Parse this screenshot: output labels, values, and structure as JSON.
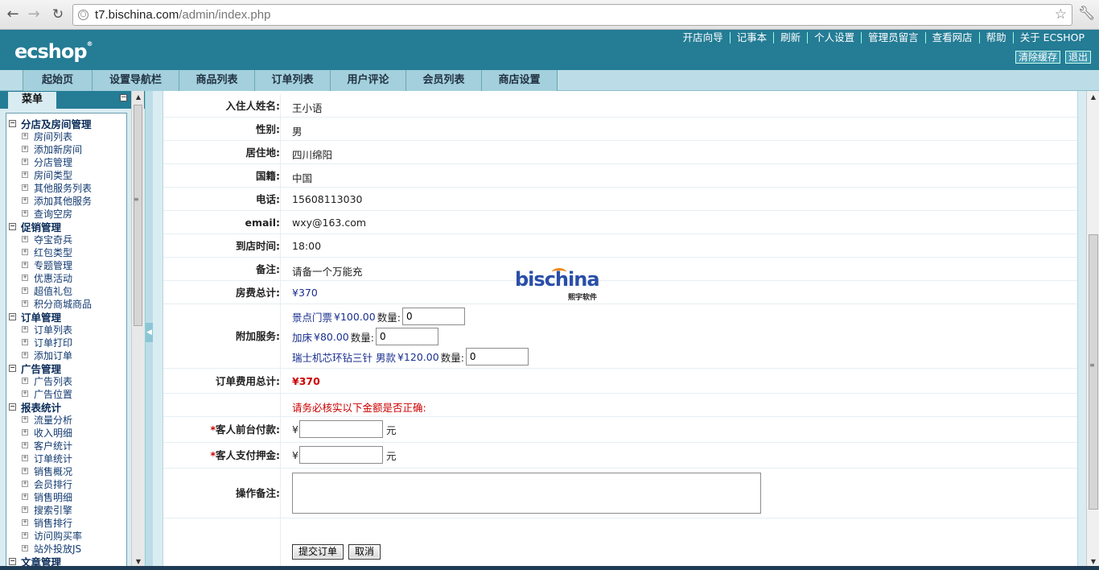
{
  "browser": {
    "url_host": "t7.bischina.com",
    "url_path": "/admin/index.php",
    "icons": [
      "back-icon",
      "forward-icon",
      "reload-icon",
      "page-icon",
      "star-icon",
      "wrench-icon"
    ]
  },
  "header": {
    "logo": "ECSHOP",
    "top_links": [
      "开店向导",
      "记事本",
      "刷新",
      "个人设置",
      "管理员留言",
      "查看网店",
      "帮助",
      "关于 ECSHOP"
    ],
    "clear_cache": "清除缓存",
    "logout": "退出",
    "brand_color": "#247c95"
  },
  "topnav": {
    "tabs": [
      "起始页",
      "设置导航栏",
      "商品列表",
      "订单列表",
      "用户评论",
      "会员列表",
      "商店设置"
    ]
  },
  "sidebar": {
    "menu_title": "菜单",
    "collapse_symbol": "−",
    "groups": [
      {
        "label": "分店及房间管理",
        "items": [
          "房间列表",
          "添加新房间",
          "分店管理",
          "房间类型",
          "其他服务列表",
          "添加其他服务",
          "查询空房"
        ]
      },
      {
        "label": "促销管理",
        "items": [
          "夺宝奇兵",
          "红包类型",
          "专题管理",
          "优惠活动",
          "超值礼包",
          "积分商城商品"
        ]
      },
      {
        "label": "订单管理",
        "items": [
          "订单列表",
          "订单打印",
          "添加订单"
        ]
      },
      {
        "label": "广告管理",
        "items": [
          "广告列表",
          "广告位置"
        ]
      },
      {
        "label": "报表统计",
        "items": [
          "流量分析",
          "收入明细",
          "客户统计",
          "订单统计",
          "销售概况",
          "会员排行",
          "销售明细",
          "搜索引擎",
          "销售排行",
          "访问购买率",
          "站外投放JS"
        ]
      },
      {
        "label": "文章管理",
        "items": []
      }
    ]
  },
  "form": {
    "guest_name_label": "入住人姓名:",
    "guest_name": "王小语",
    "gender_label": "性别:",
    "gender": "男",
    "residence_label": "居住地:",
    "residence": "四川绵阳",
    "nationality_label": "国籍:",
    "nationality": "中国",
    "phone_label": "电话:",
    "phone": "15608113030",
    "email_label": "email:",
    "email": "wxy@163.com",
    "arrival_label": "到店时间:",
    "arrival": "18:00",
    "note_label": "备注:",
    "note": "请备一个万能充",
    "room_total_label": "房费总计:",
    "room_total": "¥370",
    "extra_label": "附加服务:",
    "qty_label": "数量:",
    "services": [
      {
        "name": "景点门票",
        "price": "¥100.00",
        "qty": "0"
      },
      {
        "name": "加床",
        "price": "¥80.00",
        "qty": "0"
      },
      {
        "name": "瑞士机芯环钻三针 男款",
        "price": "¥120.00",
        "qty": "0"
      }
    ],
    "order_total_label": "订单费用总计:",
    "order_total": "¥370",
    "verify_notice": "请务必核实以下金额是否正确:",
    "required_mark": "*",
    "front_pay_label": "客人前台付款:",
    "deposit_label": "客人支付押金:",
    "currency_symbol": "¥",
    "unit": "元",
    "front_pay_value": "",
    "deposit_value": "",
    "op_note_label": "操作备注:",
    "op_note_value": "",
    "submit": "提交订单",
    "cancel": "取消"
  },
  "watermark": {
    "text": "bischina",
    "sub": "熙宇软件"
  }
}
